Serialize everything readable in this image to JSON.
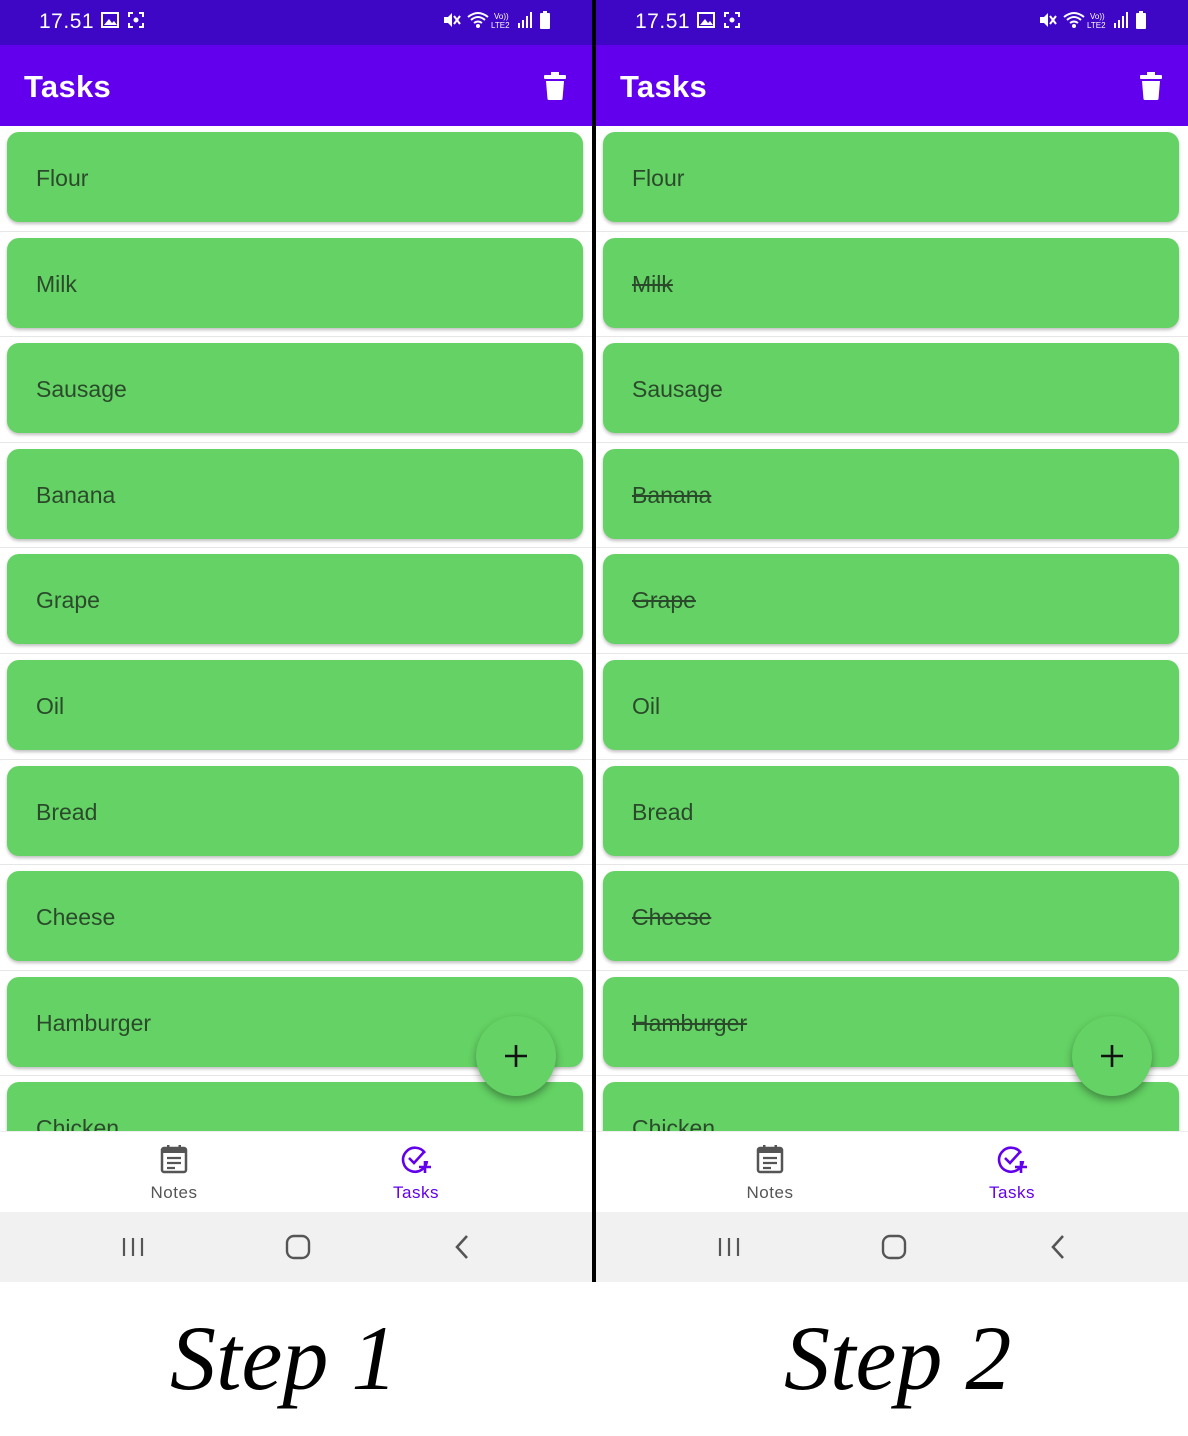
{
  "screens": [
    {
      "status_time": "17.51",
      "app_title": "Tasks",
      "tasks": [
        {
          "label": "Flour",
          "done": false
        },
        {
          "label": "Milk",
          "done": false
        },
        {
          "label": "Sausage",
          "done": false
        },
        {
          "label": "Banana",
          "done": false
        },
        {
          "label": "Grape",
          "done": false
        },
        {
          "label": "Oil",
          "done": false
        },
        {
          "label": "Bread",
          "done": false
        },
        {
          "label": "Cheese",
          "done": false
        },
        {
          "label": "Hamburger",
          "done": false
        },
        {
          "label": "Chicken",
          "done": false
        }
      ],
      "nav": {
        "notes_label": "Notes",
        "tasks_label": "Tasks",
        "active": "tasks"
      },
      "caption": "Step 1"
    },
    {
      "status_time": "17.51",
      "app_title": "Tasks",
      "tasks": [
        {
          "label": "Flour",
          "done": false
        },
        {
          "label": "Milk",
          "done": true
        },
        {
          "label": "Sausage",
          "done": false
        },
        {
          "label": "Banana",
          "done": true
        },
        {
          "label": "Grape",
          "done": true
        },
        {
          "label": "Oil",
          "done": false
        },
        {
          "label": "Bread",
          "done": false
        },
        {
          "label": "Cheese",
          "done": true
        },
        {
          "label": "Hamburger",
          "done": true
        },
        {
          "label": "Chicken",
          "done": false
        }
      ],
      "nav": {
        "notes_label": "Notes",
        "tasks_label": "Tasks",
        "active": "tasks"
      },
      "caption": "Step 2"
    }
  ],
  "icons": {
    "status": [
      "gallery-icon",
      "screen-record-icon",
      "mute-icon",
      "wifi-icon",
      "volte-icon",
      "signal-icon",
      "battery-icon"
    ],
    "app_bar_action": "trash-icon",
    "fab": "plus-icon",
    "nav_notes": "notes-icon",
    "nav_tasks": "task-add-icon",
    "system": [
      "recents-icon",
      "home-icon",
      "back-icon"
    ]
  },
  "colors": {
    "status_bar": "#3e06c5",
    "app_bar": "#6200ee",
    "card": "#64d264",
    "card_text": "#2b4a2b",
    "active_nav": "#6200ee"
  }
}
